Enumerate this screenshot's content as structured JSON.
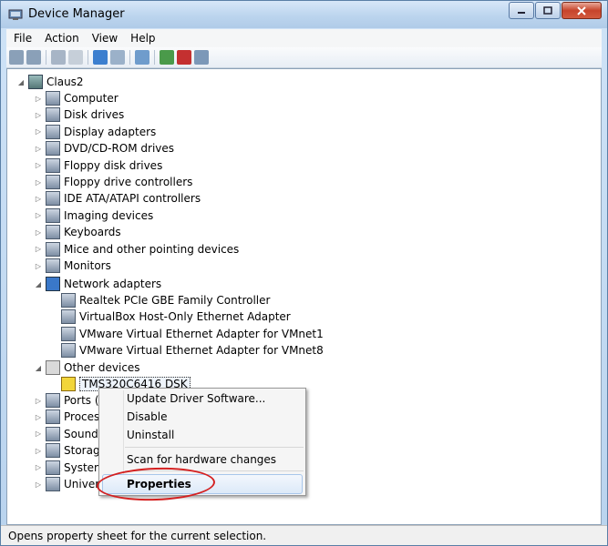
{
  "window": {
    "title": "Device Manager"
  },
  "menu": [
    "File",
    "Action",
    "View",
    "Help"
  ],
  "tree": {
    "root": "Claus2",
    "categories": [
      {
        "label": "Computer",
        "icon": "computer-icon"
      },
      {
        "label": "Disk drives",
        "icon": "disk-drive-icon"
      },
      {
        "label": "Display adapters",
        "icon": "display-adapter-icon"
      },
      {
        "label": "DVD/CD-ROM drives",
        "icon": "dvd-drive-icon"
      },
      {
        "label": "Floppy disk drives",
        "icon": "floppy-drive-icon"
      },
      {
        "label": "Floppy drive controllers",
        "icon": "floppy-controller-icon"
      },
      {
        "label": "IDE ATA/ATAPI controllers",
        "icon": "ide-controller-icon"
      },
      {
        "label": "Imaging devices",
        "icon": "camera-icon"
      },
      {
        "label": "Keyboards",
        "icon": "keyboard-icon"
      },
      {
        "label": "Mice and other pointing devices",
        "icon": "mouse-icon"
      },
      {
        "label": "Monitors",
        "icon": "monitor-icon"
      }
    ],
    "network": {
      "label": "Network adapters",
      "children": [
        "Realtek PCIe GBE Family Controller",
        "VirtualBox Host-Only Ethernet Adapter",
        "VMware Virtual Ethernet Adapter for VMnet1",
        "VMware Virtual Ethernet Adapter for VMnet8"
      ]
    },
    "other": {
      "label": "Other devices",
      "child": "TMS320C6416 DSK"
    },
    "after": [
      "Ports (C",
      "Process",
      "Sound,",
      "Storag",
      "System",
      "Univers"
    ]
  },
  "context_menu": {
    "items": [
      "Update Driver Software...",
      "Disable",
      "Uninstall",
      "Scan for hardware changes",
      "Properties"
    ],
    "highlighted": "Properties"
  },
  "status": "Opens property sheet for the current selection.",
  "colors": {
    "accent": "#3c7fcf",
    "annotation": "#d42020"
  }
}
